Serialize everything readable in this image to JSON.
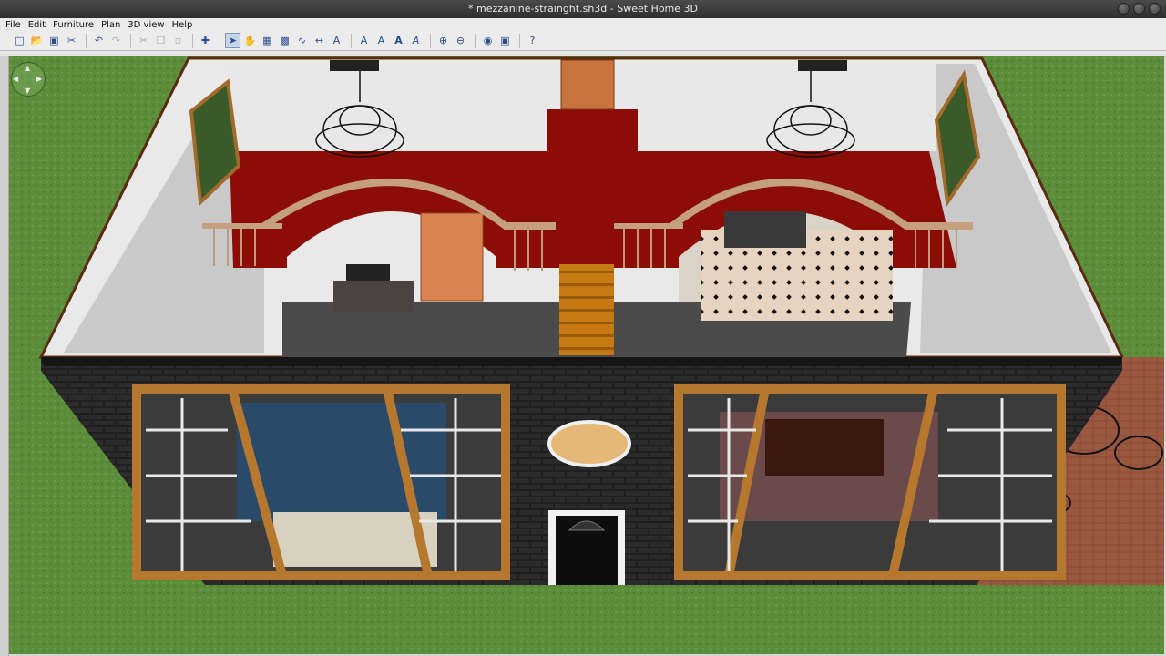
{
  "window": {
    "title": "* mezzanine-strainght.sh3d - Sweet Home 3D"
  },
  "menu": [
    "File",
    "Edit",
    "Furniture",
    "Plan",
    "3D view",
    "Help"
  ],
  "toolbar": {
    "icons": [
      "new-file-icon",
      "open-icon",
      "save-icon",
      "preferences-icon",
      "undo-icon",
      "redo-icon",
      "cut-icon",
      "copy-icon",
      "paste-icon",
      "add-furniture-icon",
      "select-icon",
      "pan-icon",
      "create-walls-icon",
      "create-rooms-icon",
      "create-polylines-icon",
      "create-dimensions-icon",
      "add-text-icon",
      "increase-text-size-icon",
      "decrease-text-size-icon",
      "bold-text-icon",
      "italic-text-icon",
      "zoom-in-icon",
      "zoom-out-icon",
      "create-photo-icon",
      "create-video-icon",
      "help-icon"
    ]
  },
  "colors": {
    "grass": "#5c8d3b",
    "brick": "#222222",
    "carpet_red": "#8c0d06",
    "wood": "#b86b1e"
  }
}
